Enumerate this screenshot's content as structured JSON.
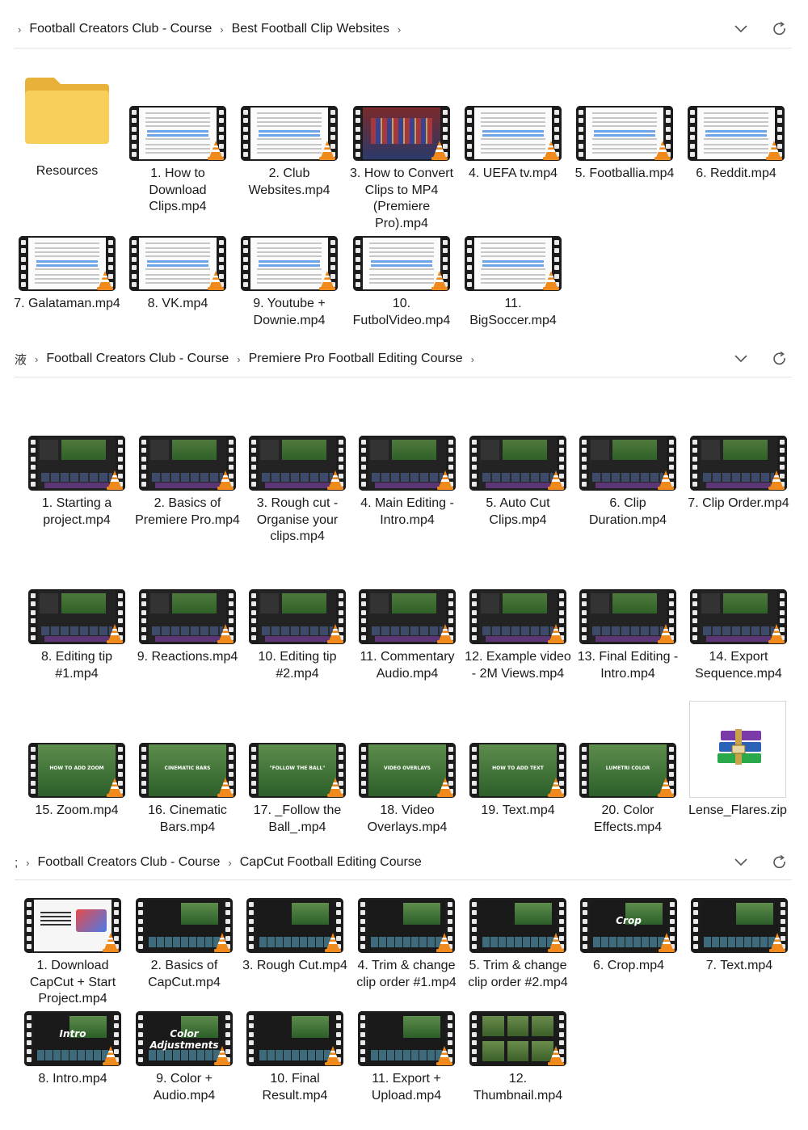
{
  "window1": {
    "breadcrumb": [
      "Football Creators Club - Course",
      "Best Football Clip Websites"
    ],
    "items": [
      {
        "label": "Resources",
        "kind": "folder"
      },
      {
        "label": "1. How to Download Clips.mp4",
        "kind": "doc"
      },
      {
        "label": "2. Club Websites.mp4",
        "kind": "doc"
      },
      {
        "label": "3. How to Convert Clips to MP4 (Premiere Pro).mp4",
        "kind": "crowd"
      },
      {
        "label": "4. UEFA tv.mp4",
        "kind": "doc"
      },
      {
        "label": "5. Footballia.mp4",
        "kind": "doc"
      },
      {
        "label": "6. Reddit.mp4",
        "kind": "doc"
      },
      {
        "label": "7. Galataman.mp4",
        "kind": "doc"
      },
      {
        "label": "8. VK.mp4",
        "kind": "doc"
      },
      {
        "label": "9. Youtube + Downie.mp4",
        "kind": "doc"
      },
      {
        "label": "10. FutbolVideo.mp4",
        "kind": "doc"
      },
      {
        "label": "11. BigSoccer.mp4",
        "kind": "doc"
      }
    ]
  },
  "window2": {
    "lead": "液",
    "breadcrumb": [
      "Football Creators Club - Course",
      "Premiere Pro Football Editing Course"
    ],
    "items": [
      {
        "label": "1. Starting a project.mp4",
        "kind": "editor"
      },
      {
        "label": "2. Basics of Premiere Pro.mp4",
        "kind": "editor"
      },
      {
        "label": "3. Rough cut - Organise your clips.mp4",
        "kind": "editor"
      },
      {
        "label": "4. Main Editing - Intro.mp4",
        "kind": "editor"
      },
      {
        "label": "5. Auto Cut Clips.mp4",
        "kind": "editor"
      },
      {
        "label": "6. Clip Duration.mp4",
        "kind": "editor"
      },
      {
        "label": "7. Clip Order.mp4",
        "kind": "editor"
      },
      {
        "label": "8. Editing tip #1.mp4",
        "kind": "editor"
      },
      {
        "label": "9. Reactions.mp4",
        "kind": "editor"
      },
      {
        "label": "10. Editing tip #2.mp4",
        "kind": "editor"
      },
      {
        "label": "11. Commentary Audio.mp4",
        "kind": "editor"
      },
      {
        "label": "12. Example video - 2M Views.mp4",
        "kind": "editor"
      },
      {
        "label": "13. Final Editing - Intro.mp4",
        "kind": "editor"
      },
      {
        "label": "14. Export Sequence.mp4",
        "kind": "editor"
      },
      {
        "label": "15. Zoom.mp4",
        "kind": "field",
        "overlay": "HOW TO ADD ZOOM"
      },
      {
        "label": "16. Cinematic Bars.mp4",
        "kind": "field",
        "overlay": "CINEMATIC BARS"
      },
      {
        "label": "17. _Follow the Ball_.mp4",
        "kind": "field",
        "overlay": "\"FOLLOW THE BALL\""
      },
      {
        "label": "18. Video Overlays.mp4",
        "kind": "field",
        "overlay": "VIDEO OVERLAYS"
      },
      {
        "label": "19. Text.mp4",
        "kind": "field",
        "overlay": "HOW TO ADD TEXT"
      },
      {
        "label": "20. Color Effects.mp4",
        "kind": "field",
        "overlay": "LUMETRI COLOR"
      },
      {
        "label": "Lense_Flares.zip",
        "kind": "zip"
      }
    ]
  },
  "window3": {
    "lead": ";",
    "breadcrumb": [
      "Football Creators Club - Course",
      "CapCut Football Editing Course"
    ],
    "items": [
      {
        "label": "1. Download CapCut + Start Project.mp4",
        "kind": "web"
      },
      {
        "label": "2. Basics of CapCut.mp4",
        "kind": "capcut"
      },
      {
        "label": "3. Rough Cut.mp4",
        "kind": "capcut"
      },
      {
        "label": "4. Trim & change clip order #1.mp4",
        "kind": "capcut"
      },
      {
        "label": "5. Trim & change clip order #2.mp4",
        "kind": "capcut"
      },
      {
        "label": "6. Crop.mp4",
        "kind": "capcut",
        "overlay": "Crop"
      },
      {
        "label": "7. Text.mp4",
        "kind": "capcut"
      },
      {
        "label": "8. Intro.mp4",
        "kind": "capcut",
        "overlay": "Intro"
      },
      {
        "label": "9. Color + Audio.mp4",
        "kind": "capcut",
        "overlay": "Color Adjustments"
      },
      {
        "label": "10. Final Result.mp4",
        "kind": "capcut"
      },
      {
        "label": "11. Export + Upload.mp4",
        "kind": "capcut"
      },
      {
        "label": "12. Thumbnail.mp4",
        "kind": "grid"
      }
    ]
  },
  "colors": {
    "folder": "#f6c944",
    "cone": "#f08a1c",
    "highlight": "#6ea4e8"
  }
}
